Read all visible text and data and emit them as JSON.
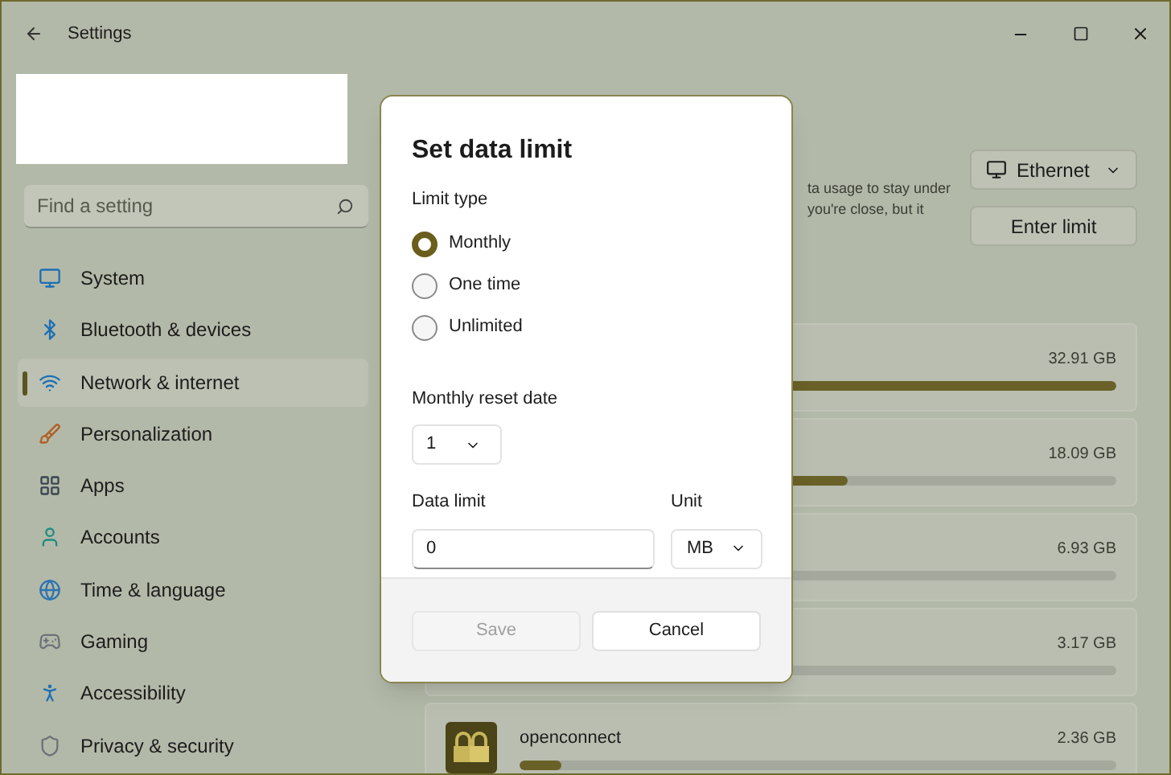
{
  "window": {
    "title": "Settings"
  },
  "sidebar": {
    "search": {
      "placeholder": "Find a setting"
    },
    "items": [
      {
        "label": "System",
        "selected": false
      },
      {
        "label": "Bluetooth & devices",
        "selected": false
      },
      {
        "label": "Network & internet",
        "selected": true
      },
      {
        "label": "Personalization",
        "selected": false
      },
      {
        "label": "Apps",
        "selected": false
      },
      {
        "label": "Accounts",
        "selected": false
      },
      {
        "label": "Time & language",
        "selected": false
      },
      {
        "label": "Gaming",
        "selected": false
      },
      {
        "label": "Accessibility",
        "selected": false
      },
      {
        "label": "Privacy & security",
        "selected": false
      }
    ]
  },
  "main": {
    "description": [
      "ta usage to stay under",
      "you're close, but it"
    ],
    "network_dropdown": {
      "value": "Ethernet"
    },
    "enter_limit_button": "Enter limit",
    "usage_rows": [
      {
        "usage": "32.91 GB",
        "level": 1.0
      },
      {
        "usage": "18.09 GB",
        "level": 0.55
      },
      {
        "usage": "6.93 GB"
      },
      {
        "usage": "3.17 GB"
      },
      {
        "name": "openconnect",
        "usage": "2.36 GB",
        "level": 0.07
      }
    ]
  },
  "dialog": {
    "title": "Set data limit",
    "limit_type_label": "Limit type",
    "limit_types": [
      {
        "label": "Monthly",
        "selected": true
      },
      {
        "label": "One time",
        "selected": false
      },
      {
        "label": "Unlimited",
        "selected": false
      }
    ],
    "reset_date_label": "Monthly reset date",
    "reset_date": "1",
    "data_limit_label": "Data limit",
    "data_limit_value": "0",
    "unit_label": "Unit",
    "unit": "MB",
    "buttons": [
      {
        "label": "Save",
        "disabled": true
      },
      {
        "label": "Cancel",
        "disabled": false
      }
    ]
  }
}
